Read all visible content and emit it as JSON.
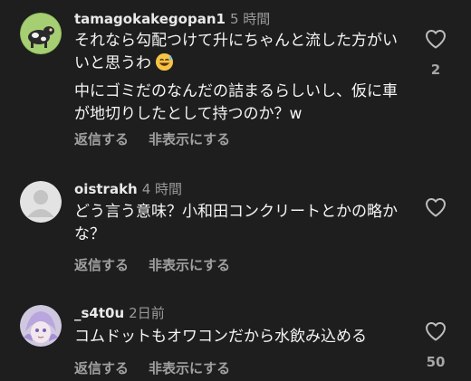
{
  "comments": [
    {
      "username": "tamagokakegopan1",
      "time": "5 時間",
      "lines": [
        "それなら勾配つけて升にちゃんと流した方がいいと思うわ",
        "中にゴミだのなんだの詰まるらしいし、仮に車が地切りしたとして持つのか？w"
      ],
      "reply_label": "返信する",
      "hide_label": "非表示にする",
      "like_count": "2",
      "avatar_icon": "cow-avatar-icon",
      "emoji_icon": "grinning-sweat-emoji"
    },
    {
      "username": "oistrakh",
      "time": "4 時間",
      "lines": [
        "どう言う意味？小和田コンクリートとかの略かな？"
      ],
      "reply_label": "返信する",
      "hide_label": "非表示にする",
      "like_count": "",
      "avatar_icon": "default-user-avatar-icon"
    },
    {
      "username": "_s4t0u",
      "time": "2日前",
      "lines": [
        "コムドットもオワコンだから水飲み込める"
      ],
      "reply_label": "返信する",
      "hide_label": "非表示にする",
      "like_count": "50",
      "avatar_icon": "anime-avatar-icon"
    }
  ],
  "colors": {
    "background": "#1e1e1e",
    "text": "#f5f5f5",
    "muted": "#9a9a9a"
  }
}
